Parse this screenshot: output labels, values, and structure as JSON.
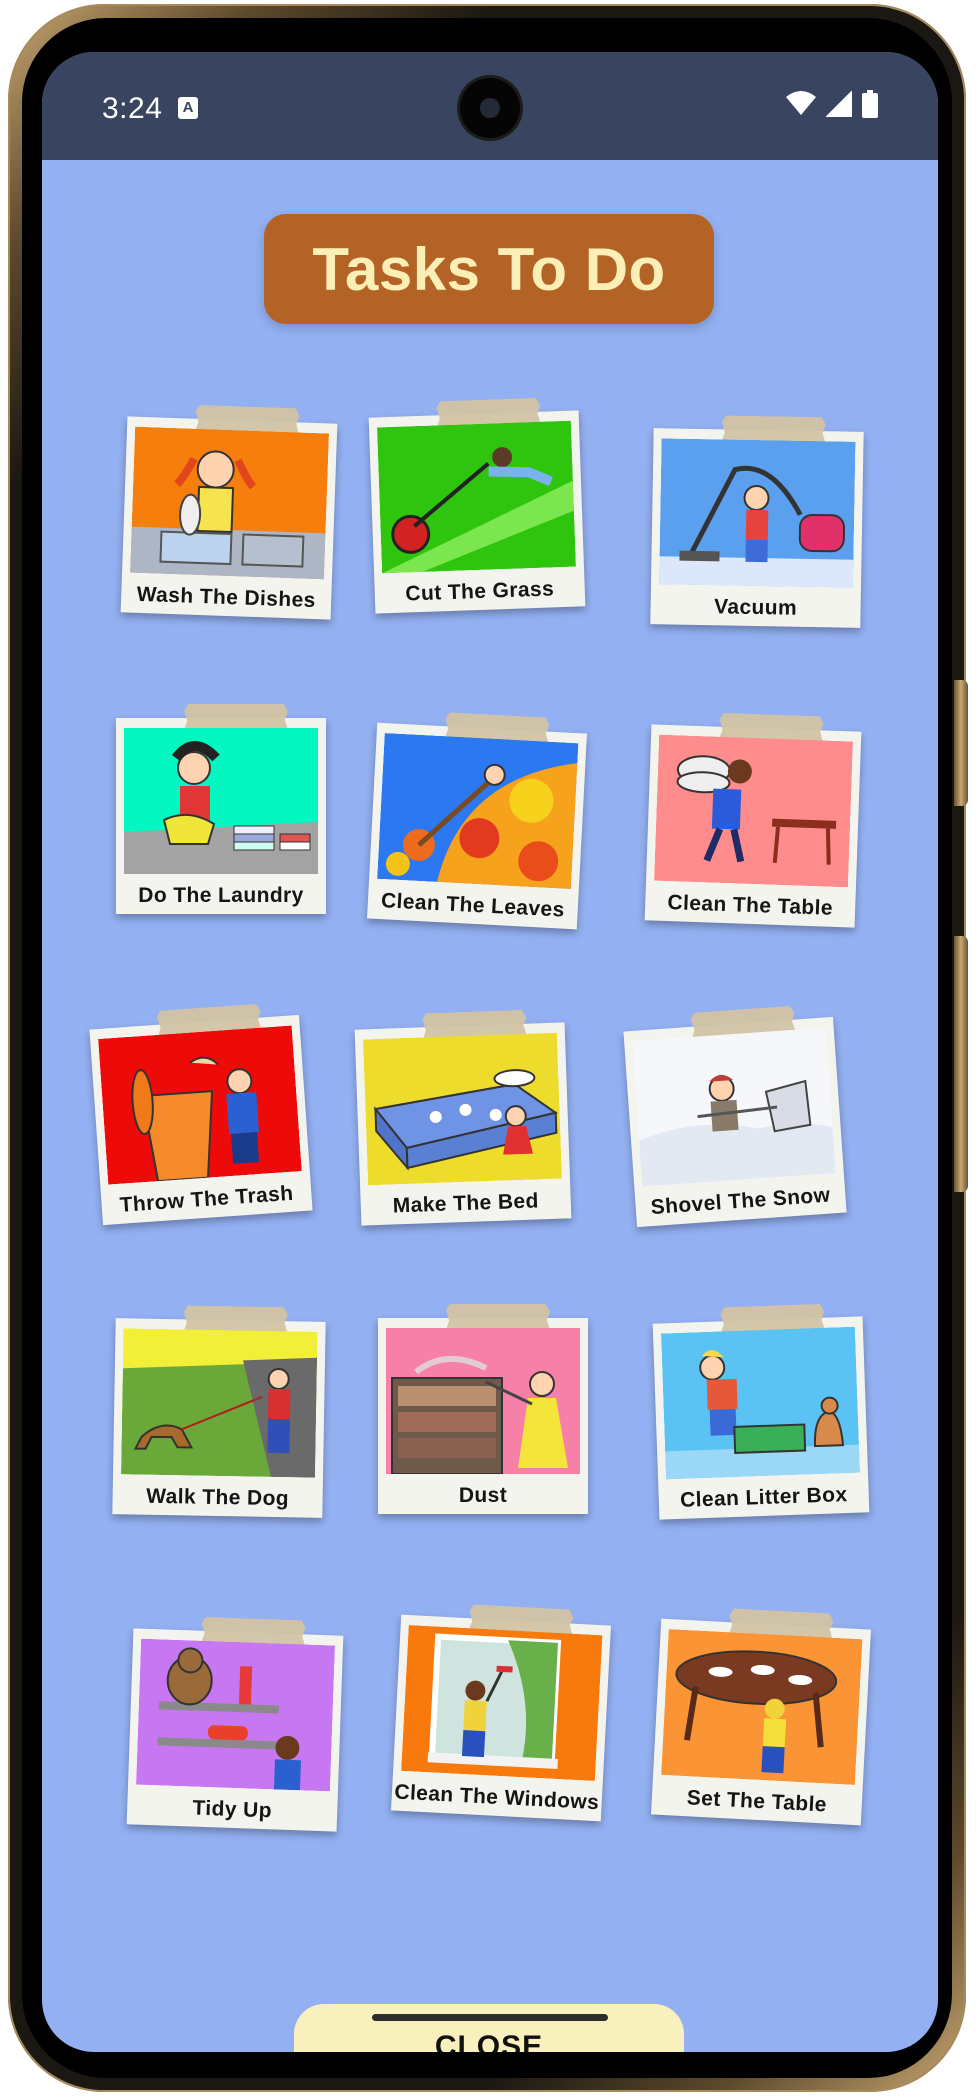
{
  "status_bar": {
    "time": "3:24",
    "notification_badge": "A",
    "icons": [
      "wifi-icon",
      "signal-icon",
      "battery-icon"
    ]
  },
  "header": {
    "title": "Tasks To Do"
  },
  "tasks": [
    {
      "label": "Wash The Dishes",
      "color": "#f57e0c"
    },
    {
      "label": "Cut The Grass",
      "color": "#2fc50f"
    },
    {
      "label": "Vacuum",
      "color": "#5ba0ef"
    },
    {
      "label": "Do The Laundry",
      "color": "#05f7c1"
    },
    {
      "label": "Clean The Leaves",
      "color": "#2b78f0"
    },
    {
      "label": "Clean The Table",
      "color": "#ff8c8c"
    },
    {
      "label": "Throw The Trash",
      "color": "#ef0a0a"
    },
    {
      "label": "Make The Bed",
      "color": "#eddc2c"
    },
    {
      "label": "Shovel The Snow",
      "color": "#f5f7fa"
    },
    {
      "label": "Walk The Dog",
      "color": "#f1ef37"
    },
    {
      "label": "Dust",
      "color": "#f780a9"
    },
    {
      "label": "Clean Litter Box",
      "color": "#5bc3f3"
    },
    {
      "label": "Tidy Up",
      "color": "#c877f3"
    },
    {
      "label": "Clean The Windows",
      "color": "#f8790c"
    },
    {
      "label": "Set The Table",
      "color": "#fa9434"
    }
  ],
  "footer": {
    "close_label": "CLOSE"
  },
  "colors": {
    "screen_background": "#93b0f2",
    "status_bar": "#394560",
    "title_background": "#b36326",
    "title_text": "#fbefb6",
    "close_button": "#f8f0bd"
  }
}
